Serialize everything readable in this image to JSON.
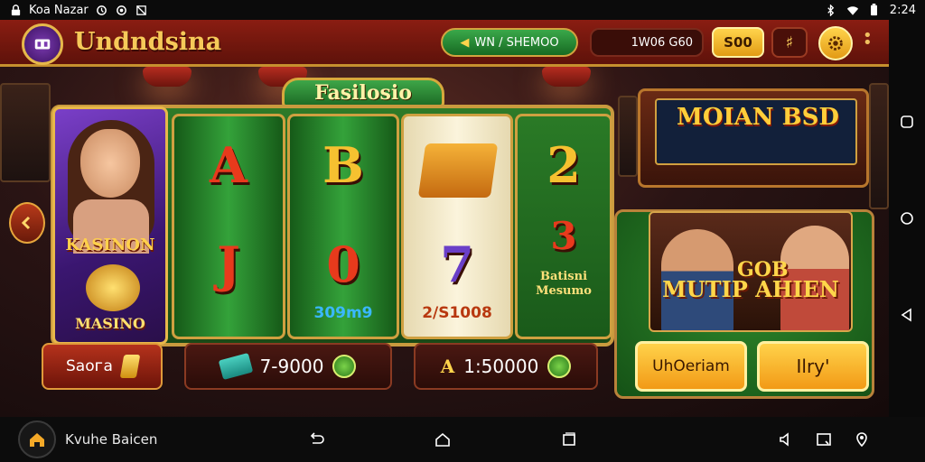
{
  "status_bar": {
    "app_name": "Koa Nazar",
    "time": "2:24"
  },
  "header": {
    "title": "Undndsina",
    "green_pill": "WN / SHEMOO",
    "dark_pill": "1W06 G60",
    "gold_button": "S00"
  },
  "machine": {
    "tab_label": "Fasilosio",
    "character": {
      "title": "KASINON",
      "subtitle": "MASINO"
    },
    "reels": [
      {
        "top": "A",
        "bottom": "J",
        "value": ""
      },
      {
        "top": "B",
        "bottom": "0",
        "value": "309m9"
      },
      {
        "top": "",
        "bottom": "7",
        "value": "2/S1008"
      },
      {
        "top": "2",
        "bottom": "3",
        "value": ""
      }
    ],
    "side_label": "Batisni Mesumo"
  },
  "lower_bar": {
    "left_button": "Saoᴦa",
    "amount_1": "7-9000",
    "amount_2": "1:50000",
    "amount_2_prefix": "A"
  },
  "right_panel": {
    "slot_title": "MOIAN BSD",
    "scene_top": "GOB",
    "scene_title": "MUTIP AHIEN",
    "button_1": "UhOeriam",
    "button_2": "Ilry'"
  },
  "bottom_nav": {
    "label": "Kvuhe Baicen"
  },
  "colors": {
    "header_red": "#8a1d12",
    "gold": "#f6c959",
    "green": "#2e7a28"
  }
}
